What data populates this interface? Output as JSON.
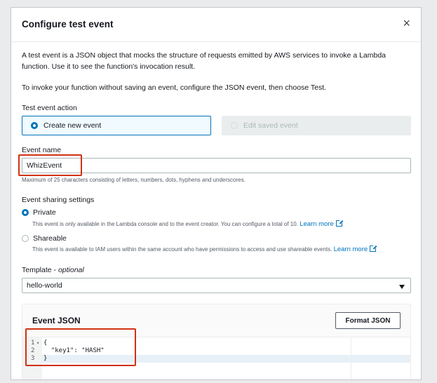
{
  "modal": {
    "title": "Configure test event",
    "close_icon": "×",
    "description_1": "A test event is a JSON object that mocks the structure of requests emitted by AWS services to invoke a Lambda function. Use it to see the function's invocation result.",
    "description_2": "To invoke your function without saving an event, configure the JSON event, then choose Test."
  },
  "test_event_action": {
    "label": "Test event action",
    "options": [
      "Create new event",
      "Edit saved event"
    ],
    "selected": "Create new event"
  },
  "event_name": {
    "label": "Event name",
    "value": "WhizEvent",
    "hint": "Maximum of 25 characters consisting of letters, numbers, dots, hyphens and underscores."
  },
  "sharing": {
    "label": "Event sharing settings",
    "private_label": "Private",
    "private_desc": "This event is only available in the Lambda console and to the event creator. You can configure a total of 10.",
    "shareable_label": "Shareable",
    "shareable_desc": "This event is available to IAM users within the same account who have permissions to access and use shareable events.",
    "learn_more": "Learn more",
    "selected": "Private"
  },
  "template": {
    "label": "Template",
    "optional": "optional",
    "value": "hello-world"
  },
  "event_json": {
    "title": "Event JSON",
    "format_button": "Format JSON",
    "line_numbers": [
      "1",
      "2",
      "3"
    ],
    "fold_marker": "▾",
    "lines": [
      "{",
      "  \"key1\": \"HASH\"",
      "}"
    ]
  },
  "colors": {
    "accent": "#0073bb",
    "highlight_box": "#d13212"
  }
}
